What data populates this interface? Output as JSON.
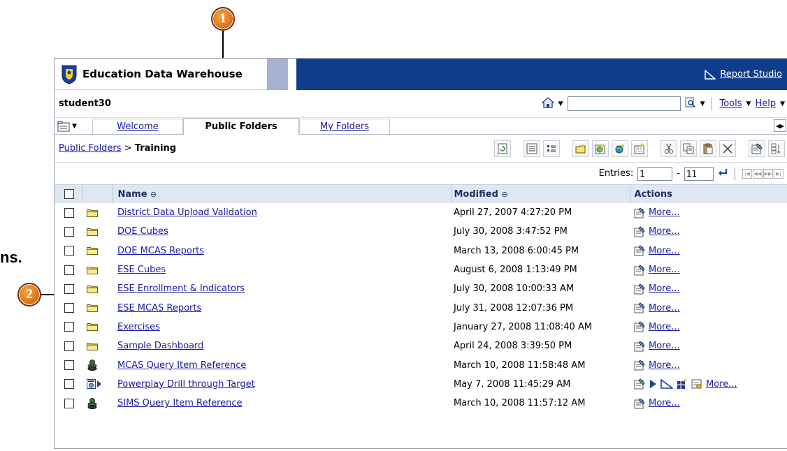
{
  "callouts": {
    "one": "1",
    "two": "2"
  },
  "partial_text": "ns.",
  "banner": {
    "brand": "Education Data Warehouse",
    "report_studio": "Report Studio"
  },
  "user": {
    "name": "student30",
    "tools": "Tools",
    "help": "Help",
    "search_value": ""
  },
  "tabs": {
    "welcome": "Welcome",
    "public_folders": "Public Folders",
    "my_folders": "My Folders"
  },
  "breadcrumb": {
    "root": "Public Folders",
    "sep": ">",
    "current": "Training"
  },
  "entries": {
    "label": "Entries:",
    "from": "1",
    "dash": "-",
    "to": "11"
  },
  "columns": {
    "name": "Name",
    "modified": "Modified",
    "actions": "Actions",
    "sort_glyph": "⊖"
  },
  "colors": {
    "banner": "#0f3d8c",
    "link": "#1a1aa6",
    "header": "#dfe7f2",
    "callout": "#e0791c"
  },
  "rows": [
    {
      "icon": "folder-icon",
      "name": "District Data Upload Validation",
      "modified": "April 27, 2007 4:27:20 PM",
      "more": "More..."
    },
    {
      "icon": "folder-icon",
      "name": "DOE Cubes",
      "modified": "July 30, 2008 3:47:52 PM",
      "more": "More..."
    },
    {
      "icon": "folder-icon",
      "name": "DOE MCAS Reports",
      "modified": "March 13, 2008 6:00:45 PM",
      "more": "More..."
    },
    {
      "icon": "folder-icon",
      "name": "ESE Cubes",
      "modified": "August 6, 2008 1:13:49 PM",
      "more": "More..."
    },
    {
      "icon": "folder-icon",
      "name": "ESE Enrollment & Indicators",
      "modified": "July 30, 2008 10:00:33 AM",
      "more": "More..."
    },
    {
      "icon": "folder-icon",
      "name": "ESE MCAS Reports",
      "modified": "July 31, 2008 12:07:36 PM",
      "more": "More..."
    },
    {
      "icon": "folder-icon",
      "name": "Exercises",
      "modified": "January 27, 2008 11:08:40 AM",
      "more": "More..."
    },
    {
      "icon": "folder-icon",
      "name": "Sample Dashboard",
      "modified": "April 24, 2008 3:39:50 PM",
      "more": "More..."
    },
    {
      "icon": "package-icon",
      "name": "MCAS Query Item Reference",
      "modified": "March 10, 2008 11:58:48 AM",
      "more": "More..."
    },
    {
      "icon": "powerplay-report-icon",
      "name": "Powerplay Drill through Target",
      "modified": "May 7, 2008 11:45:29 AM",
      "more": "More..."
    },
    {
      "icon": "package-icon",
      "name": "SIMS Query Item Reference",
      "modified": "March 10, 2008 11:57:12 AM",
      "more": "More..."
    }
  ]
}
